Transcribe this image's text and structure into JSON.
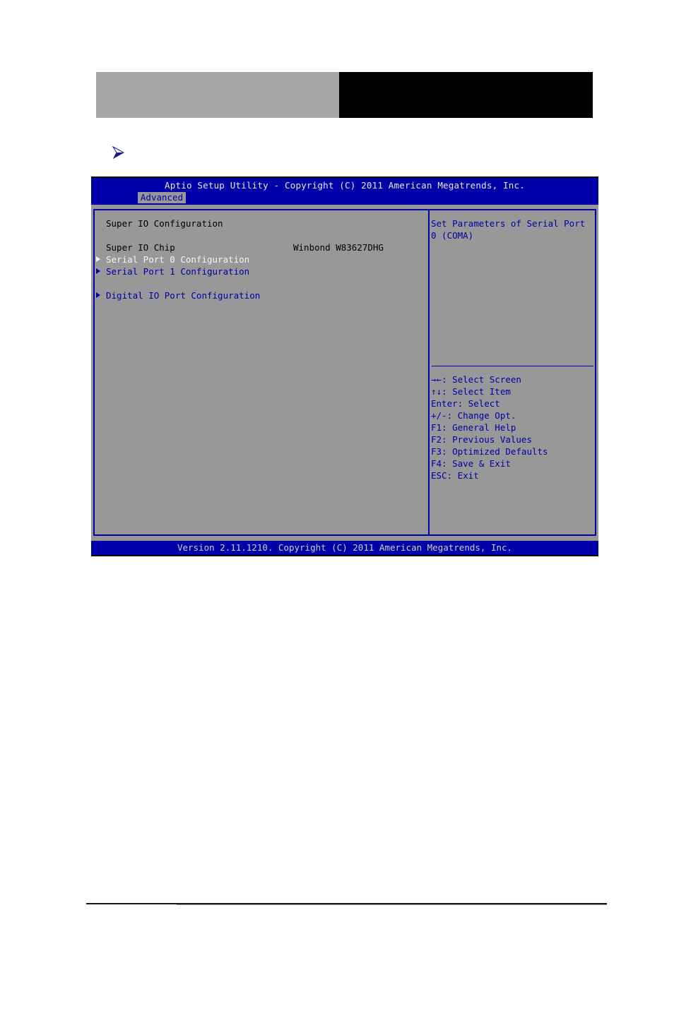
{
  "bios": {
    "title": "Aptio Setup Utility - Copyright (C) 2011 American Megatrends, Inc.",
    "tabs": [
      {
        "label": "Advanced",
        "active": true
      }
    ],
    "page_title": "Super IO Configuration",
    "info": {
      "label": "Super IO Chip",
      "value": "Winbond W83627DHG"
    },
    "menu_items": [
      {
        "label": "Serial Port 0 Configuration",
        "selected": true
      },
      {
        "label": "Serial Port 1 Configuration",
        "selected": false
      },
      {
        "label": "Digital IO Port Configuration",
        "selected": false
      }
    ],
    "help_text": [
      "Set Parameters of Serial Port",
      "0 (COMA)"
    ],
    "key_help": [
      "→←: Select Screen",
      "↑↓: Select Item",
      "Enter: Select",
      "+/-: Change Opt.",
      "F1: General Help",
      "F2: Previous Values",
      "F3: Optimized Defaults",
      "F4: Save & Exit",
      "ESC: Exit"
    ],
    "version": "Version 2.11.1210. Copyright (C) 2011 American Megatrends, Inc."
  },
  "colors": {
    "bios_blue": "#0000a8",
    "bios_gray": "#989898",
    "header_gray": "#a6a6a6",
    "bullet": "#1a1a8c"
  }
}
